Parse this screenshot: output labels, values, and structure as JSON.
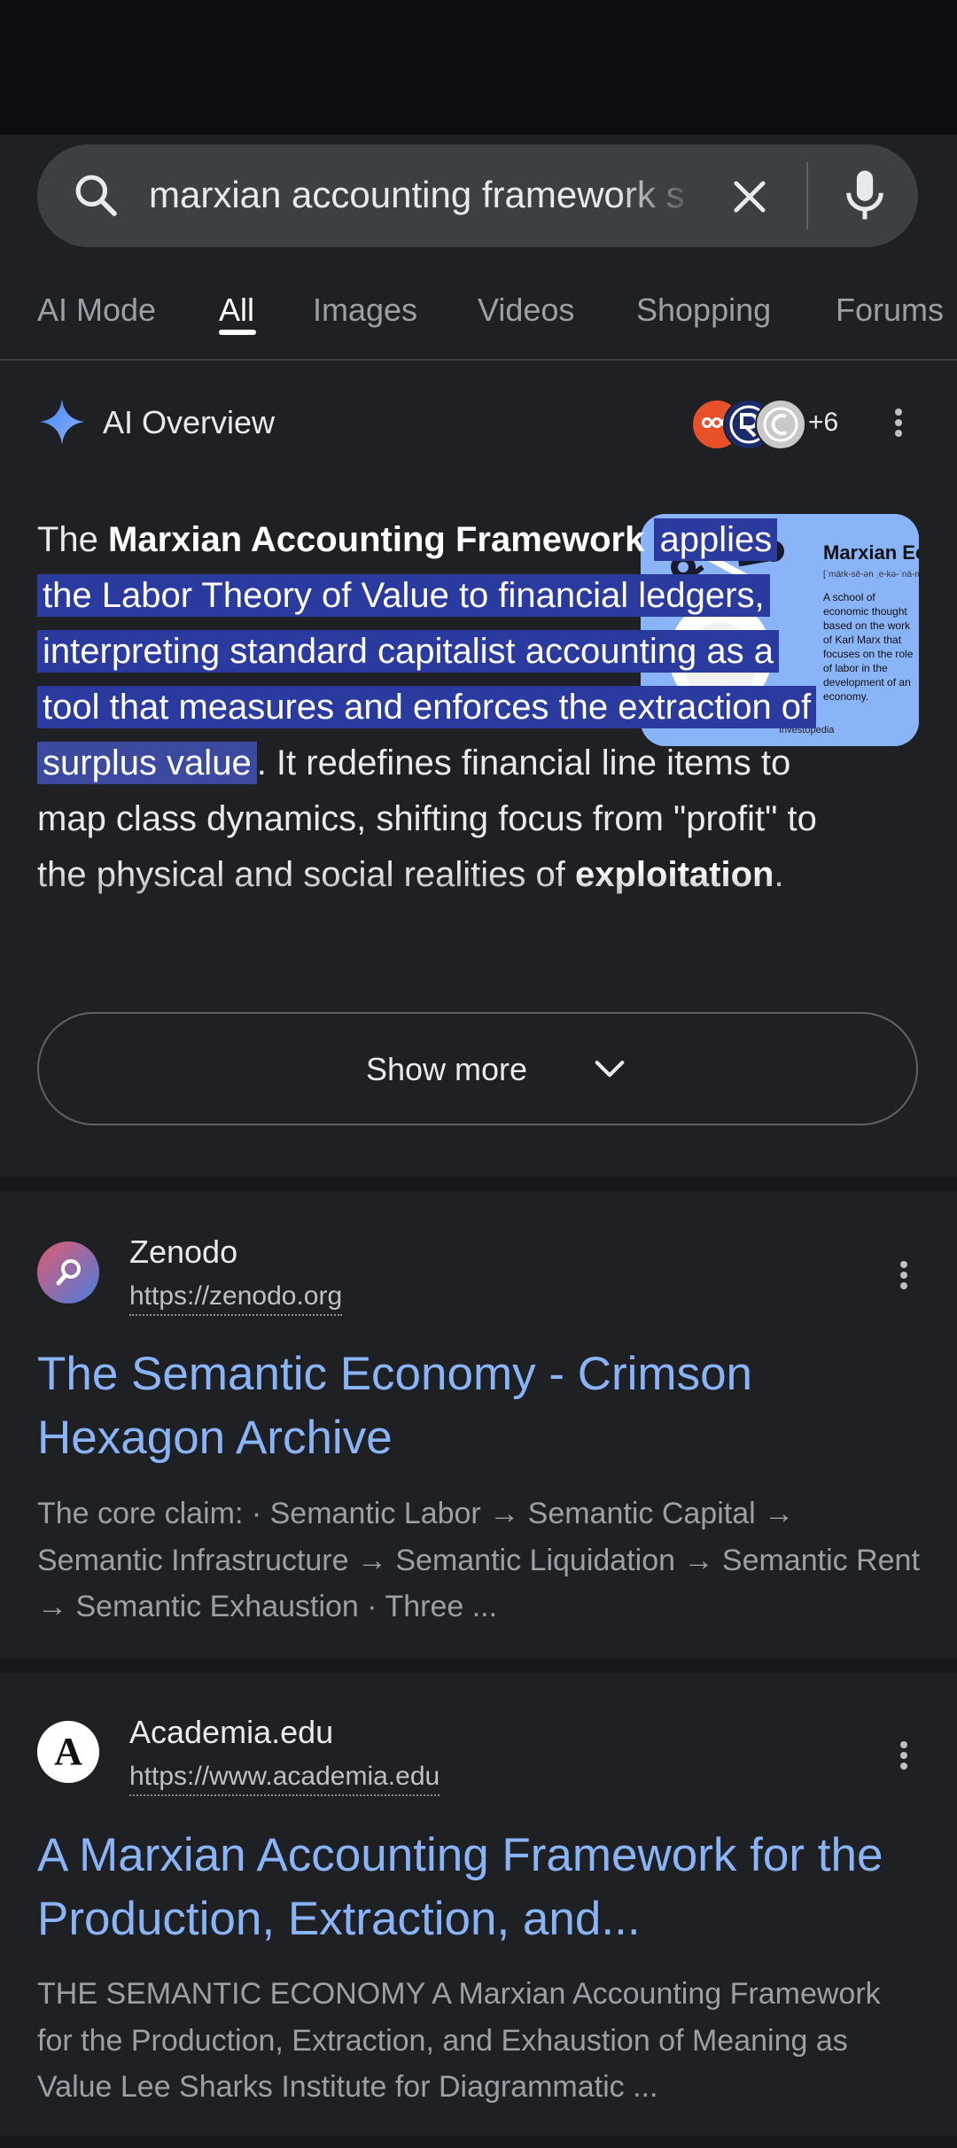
{
  "search": {
    "query": "marxian accounting framework s"
  },
  "tabs": [
    "AI Mode",
    "All",
    "Images",
    "Videos",
    "Shopping",
    "Forums"
  ],
  "ai_overview": {
    "title": "AI Overview",
    "source_count": "+6",
    "intro": "The ",
    "bold_term": "Marxian Accounting Framework",
    "highlight": "applies the Labor Theory of Value to financial ledgers, interpreting standard capitalist accounting as a tool that measures and enforces the extraction of ",
    "highlight_end": "surplus value",
    "continuation": ". It redefines financial line items to map class dynamics, shifting focus from \"profit\" to the physical and social realities of ",
    "continuation_bold": "exploitation",
    "continuation_end": ".",
    "thumbnail": {
      "heading": "Marxian Economics",
      "pronunciation": "[ˈmärk-sē-ən ˌe-kə-ˈnä-mi-ks]",
      "body": "A school of economic thought based on the work of Karl Marx that focuses on the role of labor in the development of an economy.",
      "credit": "Investopedia"
    },
    "show_more_label": "Show more"
  },
  "results": [
    {
      "site_name": "Zenodo",
      "url": "https://zenodo.org",
      "title": "The Semantic Economy - Crimson Hexagon Archive",
      "snippet": "The core claim: · Semantic Labor → Semantic Capital → Semantic Infrastructure → Semantic Liquidation → Semantic Rent → Semantic Exhaustion · Three ..."
    },
    {
      "site_name": "Academia.edu",
      "url": "https://www.academia.edu",
      "favicon_letter": "A",
      "title": "A Marxian Accounting Framework for the Production, Extraction, and...",
      "snippet": "THE SEMANTIC ECONOMY A Marxian Accounting Framework for the Production, Extraction, and Exhaustion of Meaning as Value Lee Sharks Institute for Diagrammatic ..."
    }
  ],
  "colors": {
    "background": "#1f2023",
    "link": "#8ab4f8",
    "highlight": "#2a3a9e"
  }
}
